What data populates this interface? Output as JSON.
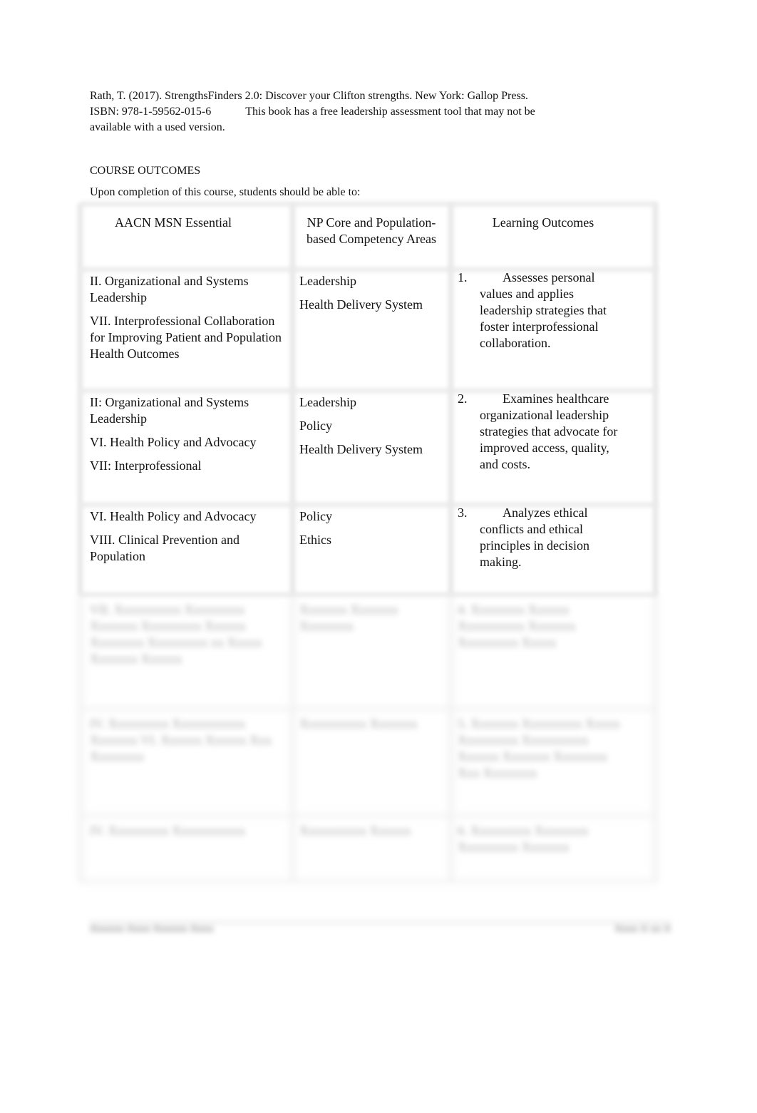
{
  "reference": {
    "line1": "Rath, T. (2017). StrengthsFinders 2.0: Discover your Clifton strengths. New York: Gallop Press.",
    "isbn": "ISBN: 978-1-59562-015-6",
    "note": "This book has a free leadership assessment tool that may not be",
    "note_cont": "available with a used version."
  },
  "section": {
    "heading": "COURSE OUTCOMES",
    "intro": "Upon completion of this course, students should be able to:"
  },
  "table": {
    "headers": [
      "AACN MSN Essential",
      "NP Core and Population-based Competency Areas",
      "Learning Outcomes"
    ],
    "rows": [
      {
        "essentials": [
          "II. Organizational and Systems Leadership",
          "VII. Interprofessional Collaboration for Improving Patient and Population Health Outcomes"
        ],
        "competencies": [
          "Leadership",
          "Health Delivery System"
        ],
        "outcome_number": "1.",
        "outcome_first": "Assesses personal",
        "outcome_rest": "values and applies leadership strategies that foster interprofessional collaboration."
      },
      {
        "essentials": [
          "II: Organizational and Systems Leadership",
          "VI. Health Policy and Advocacy",
          "VII: Interprofessional"
        ],
        "competencies": [
          "Leadership",
          "Policy",
          "Health Delivery System"
        ],
        "outcome_number": "2.",
        "outcome_first": "Examines healthcare",
        "outcome_rest": "organizational leadership strategies that advocate for improved access, quality, and costs."
      },
      {
        "essentials": [
          "VI. Health Policy and Advocacy",
          "VIII. Clinical Prevention and Population"
        ],
        "competencies": [
          "Policy",
          "Ethics"
        ],
        "outcome_number": "3.",
        "outcome_first": "Analyzes ethical",
        "outcome_rest": "conflicts and ethical principles in decision making."
      }
    ],
    "blurred_rows": [
      {
        "c1": "VII. Xxxxxxxxxx Xxxxxxxxx Xxxxxxx Xxxxxxxxx Xxxxxx Xxxxxxxx Xxxxxxxxx xx Xxxxx Xxxxxxx Xxxxxx",
        "c2": "Xxxxxxx Xxxxxxx Xxxxxxxx",
        "c3": "4. Xxxxxxxx Xxxxxx Xxxxxxxxxx Xxxxxxx Xxxxxxxxx Xxxxx"
      },
      {
        "c1": "IV. Xxxxxxxxx Xxxxxxxxxxx Xxxxxxx VI. Xxxxxx Xxxxxx Xxx Xxxxxxxx",
        "c2": "Xxxxxxxxxx Xxxxxxx",
        "c3": "5. Xxxxxxx Xxxxxxxxx Xxxxx Xxxxxxxxx Xxxxxxxxxx Xxxxxx Xxxxxxx Xxxxxxxx Xxx Xxxxxxxx"
      },
      {
        "c1": "IV. Xxxxxxxxx Xxxxxxxxxxx",
        "c2": "Xxxxxxxxxx Xxxxxx",
        "c3": "6. Xxxxxxxxx Xxxxxxxx Xxxxxxxxx Xxxxxxx"
      }
    ]
  },
  "footer": {
    "left": "Xxxxxx Xxxx Xxxxxx Xxxx",
    "right": "Xxxx X xx X"
  }
}
